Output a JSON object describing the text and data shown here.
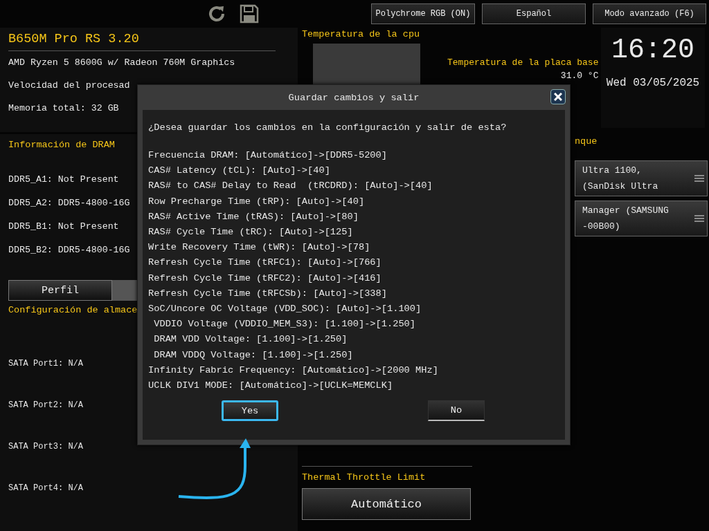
{
  "toolbar": {
    "buttons": [
      {
        "label": "Polychrome RGB (ON)"
      },
      {
        "label": "Español"
      },
      {
        "label": "Modo avanzado (F6)"
      }
    ]
  },
  "system": {
    "title": "B650M Pro RS 3.20",
    "lines": [
      "AMD Ryzen 5 8600G w/ Radeon 760M Graphics",
      "Velocidad del procesad",
      "Memoria total: 32 GB"
    ]
  },
  "dram": {
    "heading": "Información de DRAM",
    "slots": [
      "DDR5_A1: Not Present",
      "DDR5_A2: DDR5-4800-16G",
      "DDR5_B1: Not Present",
      "DDR5_B2: DDR5-4800-16G"
    ],
    "profile_button": "Perfil"
  },
  "storage": {
    "heading": "Configuración de almace",
    "ports": [
      "SATA Port1: N/A",
      "SATA Port2: N/A",
      "SATA Port3: N/A",
      "SATA Port4: N/A"
    ]
  },
  "cpu_temp": {
    "heading": "Temperatura de la cpu"
  },
  "board_temp": {
    "label": "Temperatura de la placa base",
    "value": "31.0 °C"
  },
  "clock": {
    "time": "16:20",
    "date": "Wed 03/05/2025"
  },
  "boot": {
    "heading": "nque",
    "devices": [
      {
        "lines": [
          "Ultra 1100,",
          "(SanDisk Ultra"
        ]
      },
      {
        "lines": [
          "Manager (SAMSUNG",
          "-00B00)"
        ]
      }
    ]
  },
  "thermal": {
    "heading": "Thermal Throttle Limit",
    "value": "Automático"
  },
  "dialog": {
    "title": "Guardar cambios y salir",
    "question": "¿Desea guardar los cambios en la configuración y salir de esta?",
    "changes": [
      "Frecuencia DRAM: [Automático]->[DDR5-5200]",
      "CAS# Latency (tCL): [Auto]->[40]",
      "RAS# to CAS# Delay to Read  (tRCDRD): [Auto]->[40]",
      "Row Precharge Time (tRP): [Auto]->[40]",
      "RAS# Active Time (tRAS): [Auto]->[80]",
      "RAS# Cycle Time (tRC): [Auto]->[125]",
      "Write Recovery Time (tWR): [Auto]->[78]",
      "Refresh Cycle Time (tRFC1): [Auto]->[766]",
      "Refresh Cycle Time (tRFC2): [Auto]->[416]",
      "Refresh Cycle Time (tRFCSb): [Auto]->[338]",
      "SoC/Uncore OC Voltage (VDD_SOC): [Auto]->[1.100]",
      " VDDIO Voltage (VDDIO_MEM_S3): [1.100]->[1.250]",
      " DRAM VDD Voltage: [1.100]->[1.250]",
      " DRAM VDDQ Voltage: [1.100]->[1.250]",
      "Infinity Fabric Frequency: [Automático]->[2000 MHz]",
      "UCLK DIV1 MODE: [Automático]->[UCLK=MEMCLK]"
    ],
    "buttons": [
      {
        "label": "Yes",
        "selected": true
      },
      {
        "label": "No",
        "selected": false
      }
    ]
  }
}
